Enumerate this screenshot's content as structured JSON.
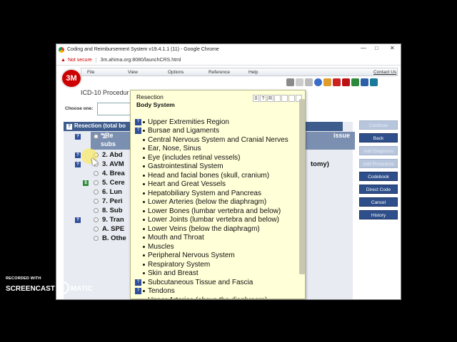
{
  "window": {
    "title": "Coding and Reimbursement System v19.4.1.1 (11) - Google Chrome",
    "minimize": "—",
    "restore": "□",
    "close": "✕"
  },
  "address": {
    "security": "Not secure",
    "url": "3m.ahima.org:8080/launchCRS.html"
  },
  "app": {
    "logo": "3M",
    "menu": [
      "File",
      "View",
      "Options",
      "Reference",
      "Help"
    ],
    "contact": "Contact Us",
    "procedure_title": "ICD-10 Procedur",
    "choose_label": "Choose one:",
    "section_title": "Resection (total bo",
    "rows": [
      {
        "q": "?",
        "num": "1.",
        "text": "* Re"
      },
      {
        "q": "?",
        "num": "2.",
        "text": "Abd"
      },
      {
        "q": "?",
        "num": "3.",
        "text": "AVM"
      },
      {
        "q": "",
        "num": "4.",
        "text": "Brea"
      },
      {
        "q": "$",
        "num": "5.",
        "text": "Cere"
      },
      {
        "q": "",
        "num": "6.",
        "text": "Lun"
      },
      {
        "q": "",
        "num": "7.",
        "text": "Peri"
      },
      {
        "q": "",
        "num": "8.",
        "text": "Sub"
      },
      {
        "q": "?",
        "num": "9.",
        "text": "Tran"
      },
      {
        "q": "",
        "num": "A.",
        "text": "SPE"
      },
      {
        "q": "",
        "num": "B.",
        "text": "Othe"
      }
    ],
    "row1_sub": "subs",
    "row1_right": "issue",
    "row3_right": "tomy)",
    "buttons": [
      {
        "label": "Continue",
        "enabled": false
      },
      {
        "label": "Back",
        "enabled": true
      },
      {
        "label": "Add Diagnosis",
        "enabled": false
      },
      {
        "label": "Add Procedure",
        "enabled": false
      },
      {
        "label": "Codebook",
        "enabled": true
      },
      {
        "label": "Direct Code",
        "enabled": true
      },
      {
        "label": "Cancel",
        "enabled": true
      },
      {
        "label": "History",
        "enabled": true
      }
    ]
  },
  "popup": {
    "title": "Resection",
    "subtitle": "Body System",
    "controls": [
      "0",
      "?",
      "R",
      "",
      "",
      "",
      ""
    ],
    "items": [
      {
        "q": true,
        "text": "Upper Extremities Region"
      },
      {
        "q": true,
        "text": "Bursae and Ligaments"
      },
      {
        "q": false,
        "text": "Central Nervous System and Cranial Nerves"
      },
      {
        "q": false,
        "text": "Ear, Nose, Sinus"
      },
      {
        "q": false,
        "text": "Eye (includes retinal vessels)"
      },
      {
        "q": false,
        "text": "Gastrointestinal System"
      },
      {
        "q": false,
        "text": "Head and facial bones (skull, cranium)"
      },
      {
        "q": false,
        "text": "Heart and Great Vessels"
      },
      {
        "q": false,
        "text": "Hepatobiliary System and Pancreas"
      },
      {
        "q": false,
        "text": "Lower Arteries (below the diaphragm)"
      },
      {
        "q": false,
        "text": "Lower Bones (lumbar vertebra and below)"
      },
      {
        "q": false,
        "text": "Lower Joints (lumbar vertebra and below)"
      },
      {
        "q": false,
        "text": "Lower Veins (below the diaphragm)"
      },
      {
        "q": false,
        "text": "Mouth and Throat"
      },
      {
        "q": false,
        "text": "Muscles"
      },
      {
        "q": false,
        "text": "Peripheral Nervous System"
      },
      {
        "q": false,
        "text": "Respiratory System"
      },
      {
        "q": false,
        "text": "Skin and Breast"
      },
      {
        "q": true,
        "text": "Subcutaneous Tissue and Fascia"
      },
      {
        "q": true,
        "text": "Tendons"
      },
      {
        "q": false,
        "text": "Upper Arteries (above the diaphragm)"
      }
    ]
  },
  "watermark": {
    "recorded": "RECORDED WITH",
    "brand_left": "SCREENCAST",
    "brand_right": "MATIC"
  }
}
